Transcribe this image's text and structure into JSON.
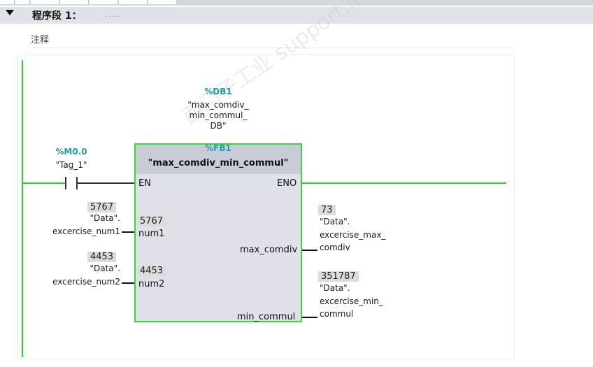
{
  "segment": {
    "title": "程序段 1：",
    "dots": "....."
  },
  "comment": {
    "text": "注释"
  },
  "instance_db": {
    "address": "%DB1",
    "name_lines": [
      "\"max_comdiv_",
      "min_commul_",
      "DB\""
    ]
  },
  "contact": {
    "address": "%M0.0",
    "tag": "\"Tag_1\""
  },
  "block": {
    "address": "%FB1",
    "name": "\"max_comdiv_min_commul\"",
    "pins": {
      "en": "EN",
      "eno": "ENO",
      "num1": "num1",
      "num2": "num2",
      "max_comdiv": "max_comdiv",
      "min_commul": "min_commul"
    },
    "num1_val": "5767",
    "num2_val": "4453"
  },
  "inputs": {
    "num1": {
      "value": "5767",
      "lines": [
        "\"Data\".",
        "excercise_num1"
      ]
    },
    "num2": {
      "value": "4453",
      "lines": [
        "\"Data\".",
        "excercise_num2"
      ]
    }
  },
  "outputs": {
    "max_comdiv": {
      "value": "73",
      "lines": [
        "\"Data\".",
        "excercise_max_",
        "comdiv"
      ]
    },
    "min_commul": {
      "value": "351787",
      "lines": [
        "\"Data\".",
        "excercise_min_",
        "commul"
      ]
    }
  },
  "watermark": {
    "text": "西门子工业 support.industry.siemens.com/cs"
  },
  "colors": {
    "wire": "#2bd42b",
    "address": "#1ba0a8",
    "block_border": "#35d835",
    "block_fill": "#dfe0e8"
  }
}
